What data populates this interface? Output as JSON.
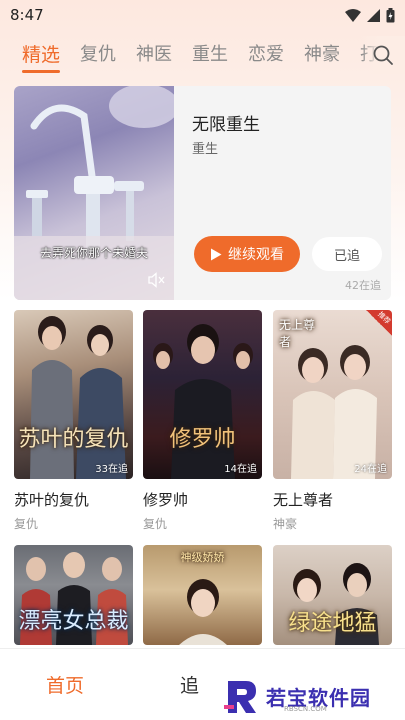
{
  "status_bar": {
    "time": "8:47"
  },
  "tabs": [
    {
      "label": "精选",
      "active": true
    },
    {
      "label": "复仇"
    },
    {
      "label": "神医"
    },
    {
      "label": "重生"
    },
    {
      "label": "恋爱"
    },
    {
      "label": "神豪"
    },
    {
      "label": "打"
    }
  ],
  "featured": {
    "caption": "去弄死你那个未婚夫",
    "title": "无限重生",
    "genre": "重生",
    "continue_label": "继续观看",
    "followed_label": "已追",
    "followers": "42在追"
  },
  "grid": [
    {
      "title": "苏叶的复仇",
      "genre": "复仇",
      "count": "33在追",
      "art": "苏叶的复仇"
    },
    {
      "title": "修罗帅",
      "genre": "复仇",
      "count": "14在追",
      "art": "修罗帅"
    },
    {
      "title": "无上尊者",
      "genre": "神豪",
      "count": "24在追",
      "art": "无上尊者",
      "badge": "推荐"
    }
  ],
  "grid_row2": [
    {
      "art": "漂亮女总裁"
    },
    {
      "art": "神级娇娇"
    },
    {
      "art": "绿途地猛"
    }
  ],
  "bottom_nav": {
    "home": "首页",
    "follow": "追"
  },
  "watermark": {
    "text": "若宝软件园",
    "sub": "RBSCN.COM"
  },
  "colors": {
    "accent": "#ef6b2b",
    "badge": "#d33b2f"
  }
}
